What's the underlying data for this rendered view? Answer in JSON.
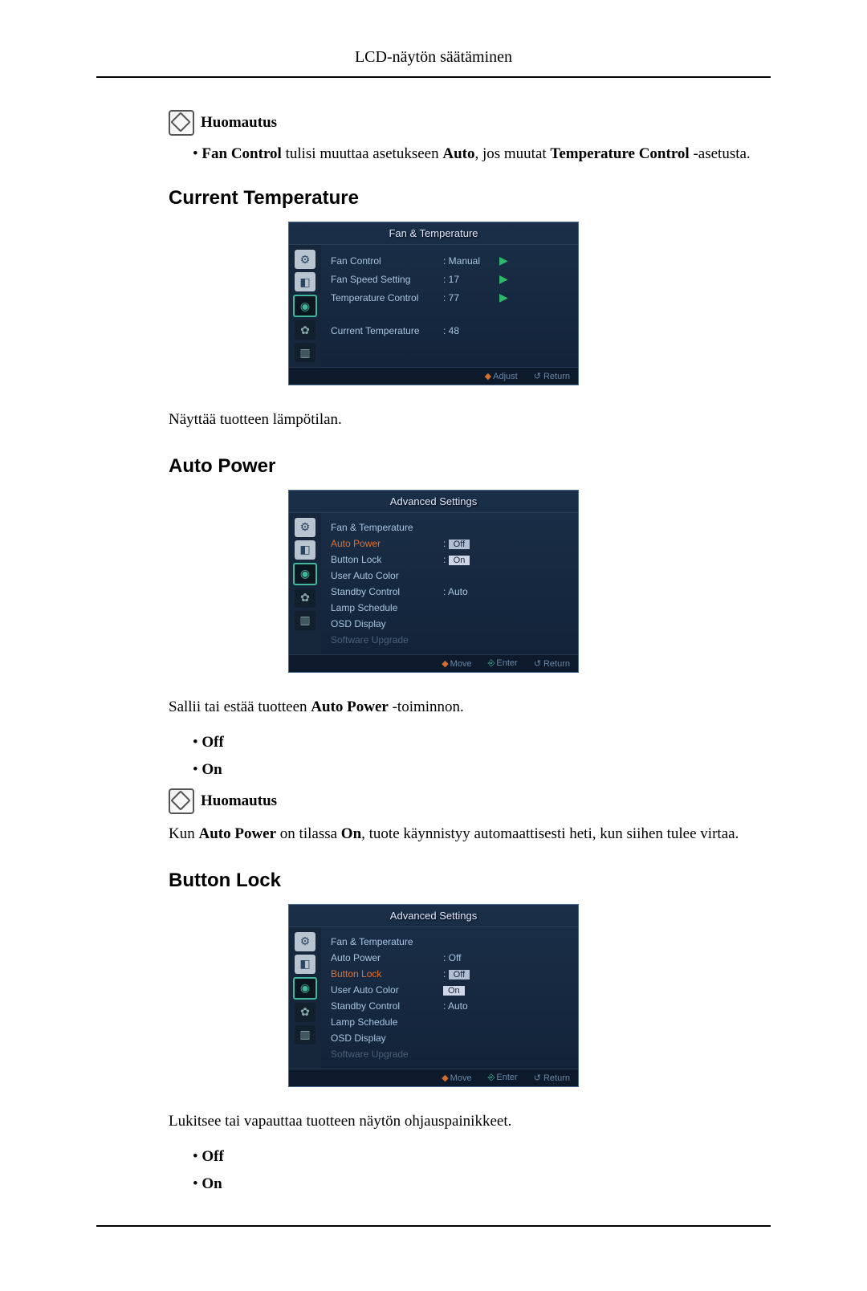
{
  "header": {
    "title": "LCD-näytön säätäminen"
  },
  "note_label": "Huomautus",
  "note1_bullet_pre": "Fan Control",
  "note1_bullet_mid1": " tulisi muuttaa asetukseen ",
  "note1_bullet_bold2": "Auto",
  "note1_bullet_mid2": ", jos muutat ",
  "note1_bullet_bold3": "Temperature Control",
  "note1_bullet_post": " -asetusta.",
  "section1": {
    "title": "Current Temperature",
    "para": "Näyttää tuotteen lämpötilan."
  },
  "osd1": {
    "title": "Fan & Temperature",
    "rows": [
      {
        "label": "Fan Control",
        "value": ": Manual",
        "arrow": "▶"
      },
      {
        "label": "Fan Speed Setting",
        "value": ": 17",
        "arrow": "▶"
      },
      {
        "label": "Temperature Control",
        "value": ": 77",
        "arrow": "▶"
      }
    ],
    "current": {
      "label": "Current Temperature",
      "value": ": 48"
    },
    "footer": {
      "adjust": "Adjust",
      "return": "Return"
    }
  },
  "section2": {
    "title": "Auto Power",
    "para_pre": "Sallii tai estää tuotteen ",
    "para_bold": "Auto Power",
    "para_post": " -toiminnon.",
    "off": "Off",
    "on": "On"
  },
  "osd2": {
    "title": "Advanced Settings",
    "items": {
      "fan_temp": "Fan & Temperature",
      "auto_power": "Auto Power",
      "button_lock": "Button Lock",
      "user_auto_color": "User Auto Color",
      "standby_control": "Standby Control",
      "lamp_schedule": "Lamp Schedule",
      "osd_display": "OSD Display",
      "software_upgrade": "Software Upgrade"
    },
    "values": {
      "auto_power": "Off",
      "button_lock": "On",
      "standby_control": ": Auto"
    },
    "footer": {
      "move": "Move",
      "enter": "Enter",
      "return": "Return"
    }
  },
  "note2_pre": "Kun ",
  "note2_b1": "Auto Power",
  "note2_mid1": " on tilassa ",
  "note2_b2": "On",
  "note2_post": ", tuote käynnistyy automaattisesti heti, kun siihen tulee virtaa.",
  "section3": {
    "title": "Button Lock",
    "para": "Lukitsee tai vapauttaa tuotteen näytön ohjauspainikkeet.",
    "off": "Off",
    "on": "On"
  },
  "osd3": {
    "title": "Advanced Settings",
    "items": {
      "fan_temp": "Fan & Temperature",
      "auto_power": "Auto Power",
      "button_lock": "Button Lock",
      "user_auto_color": "User Auto Color",
      "standby_control": "Standby Control",
      "lamp_schedule": "Lamp Schedule",
      "osd_display": "OSD Display",
      "software_upgrade": "Software Upgrade"
    },
    "values": {
      "auto_power": ": Off",
      "button_lock_off": "Off",
      "button_lock_on": "On",
      "standby_control": ": Auto"
    },
    "footer": {
      "move": "Move",
      "enter": "Enter",
      "return": "Return"
    }
  }
}
